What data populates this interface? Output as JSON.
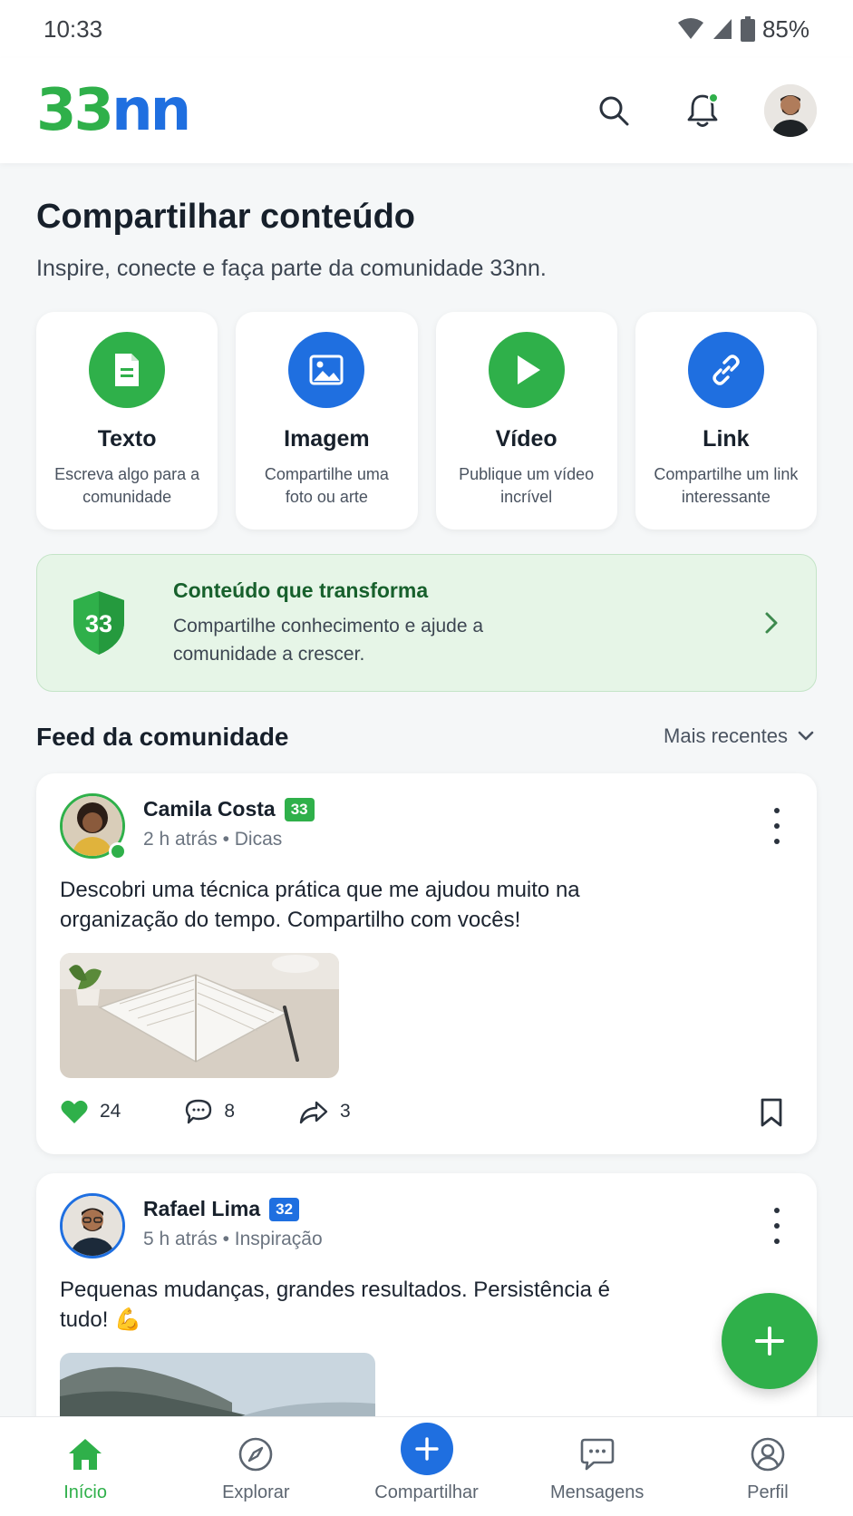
{
  "status_bar": {
    "time": "10:33",
    "battery": "85%"
  },
  "header": {
    "logo_part_1": "33",
    "logo_part_2": "nn"
  },
  "share": {
    "title": "Compartilhar conteúdo",
    "subtitle": "Inspire, conecte e faça parte da comunidade 33nn.",
    "types": [
      {
        "name": "Texto",
        "desc": "Escreva algo para a comunidade",
        "icon": "document-icon",
        "color": "#2fb04a"
      },
      {
        "name": "Imagem",
        "desc": "Compartilhe uma foto ou arte",
        "icon": "image-icon",
        "color": "#1f6fe0"
      },
      {
        "name": "Vídeo",
        "desc": "Publique um vídeo incrível",
        "icon": "play-icon",
        "color": "#2fb04a"
      },
      {
        "name": "Link",
        "desc": "Compartilhe um link interessante",
        "icon": "link-icon",
        "color": "#1f6fe0"
      }
    ]
  },
  "promo": {
    "badge": "33",
    "title": "Conteúdo que transforma",
    "desc": "Compartilhe conhecimento e ajude a comunidade a crescer."
  },
  "feed": {
    "title": "Feed da comunidade",
    "sort_label": "Mais recentes",
    "posts": [
      {
        "author": "Camila Costa",
        "level": "33",
        "time": "2 h atrás",
        "category": "Dicas",
        "text": "Descobri uma técnica prática que me ajudou muito na organização do tempo. Compartilho com vocês!",
        "likes": "24",
        "comments": "8",
        "shares": "3"
      },
      {
        "author": "Rafael Lima",
        "level": "32",
        "time": "5 h atrás",
        "category": "Inspiração",
        "text": "Pequenas mudanças, grandes resultados. Persistência é tudo! 💪"
      }
    ]
  },
  "bottom_nav": {
    "items": [
      {
        "label": "Início",
        "icon": "home-icon",
        "active": true
      },
      {
        "label": "Explorar",
        "icon": "compass-icon",
        "active": false
      },
      {
        "label": "Compartilhar",
        "icon": "plus-icon",
        "active": false
      },
      {
        "label": "Mensagens",
        "icon": "chat-icon",
        "active": false
      },
      {
        "label": "Perfil",
        "icon": "profile-icon",
        "active": false
      }
    ]
  },
  "colors": {
    "brand_green": "#2fb04a",
    "brand_blue": "#1f6fe0",
    "promo_bg": "#e6f5e7"
  }
}
